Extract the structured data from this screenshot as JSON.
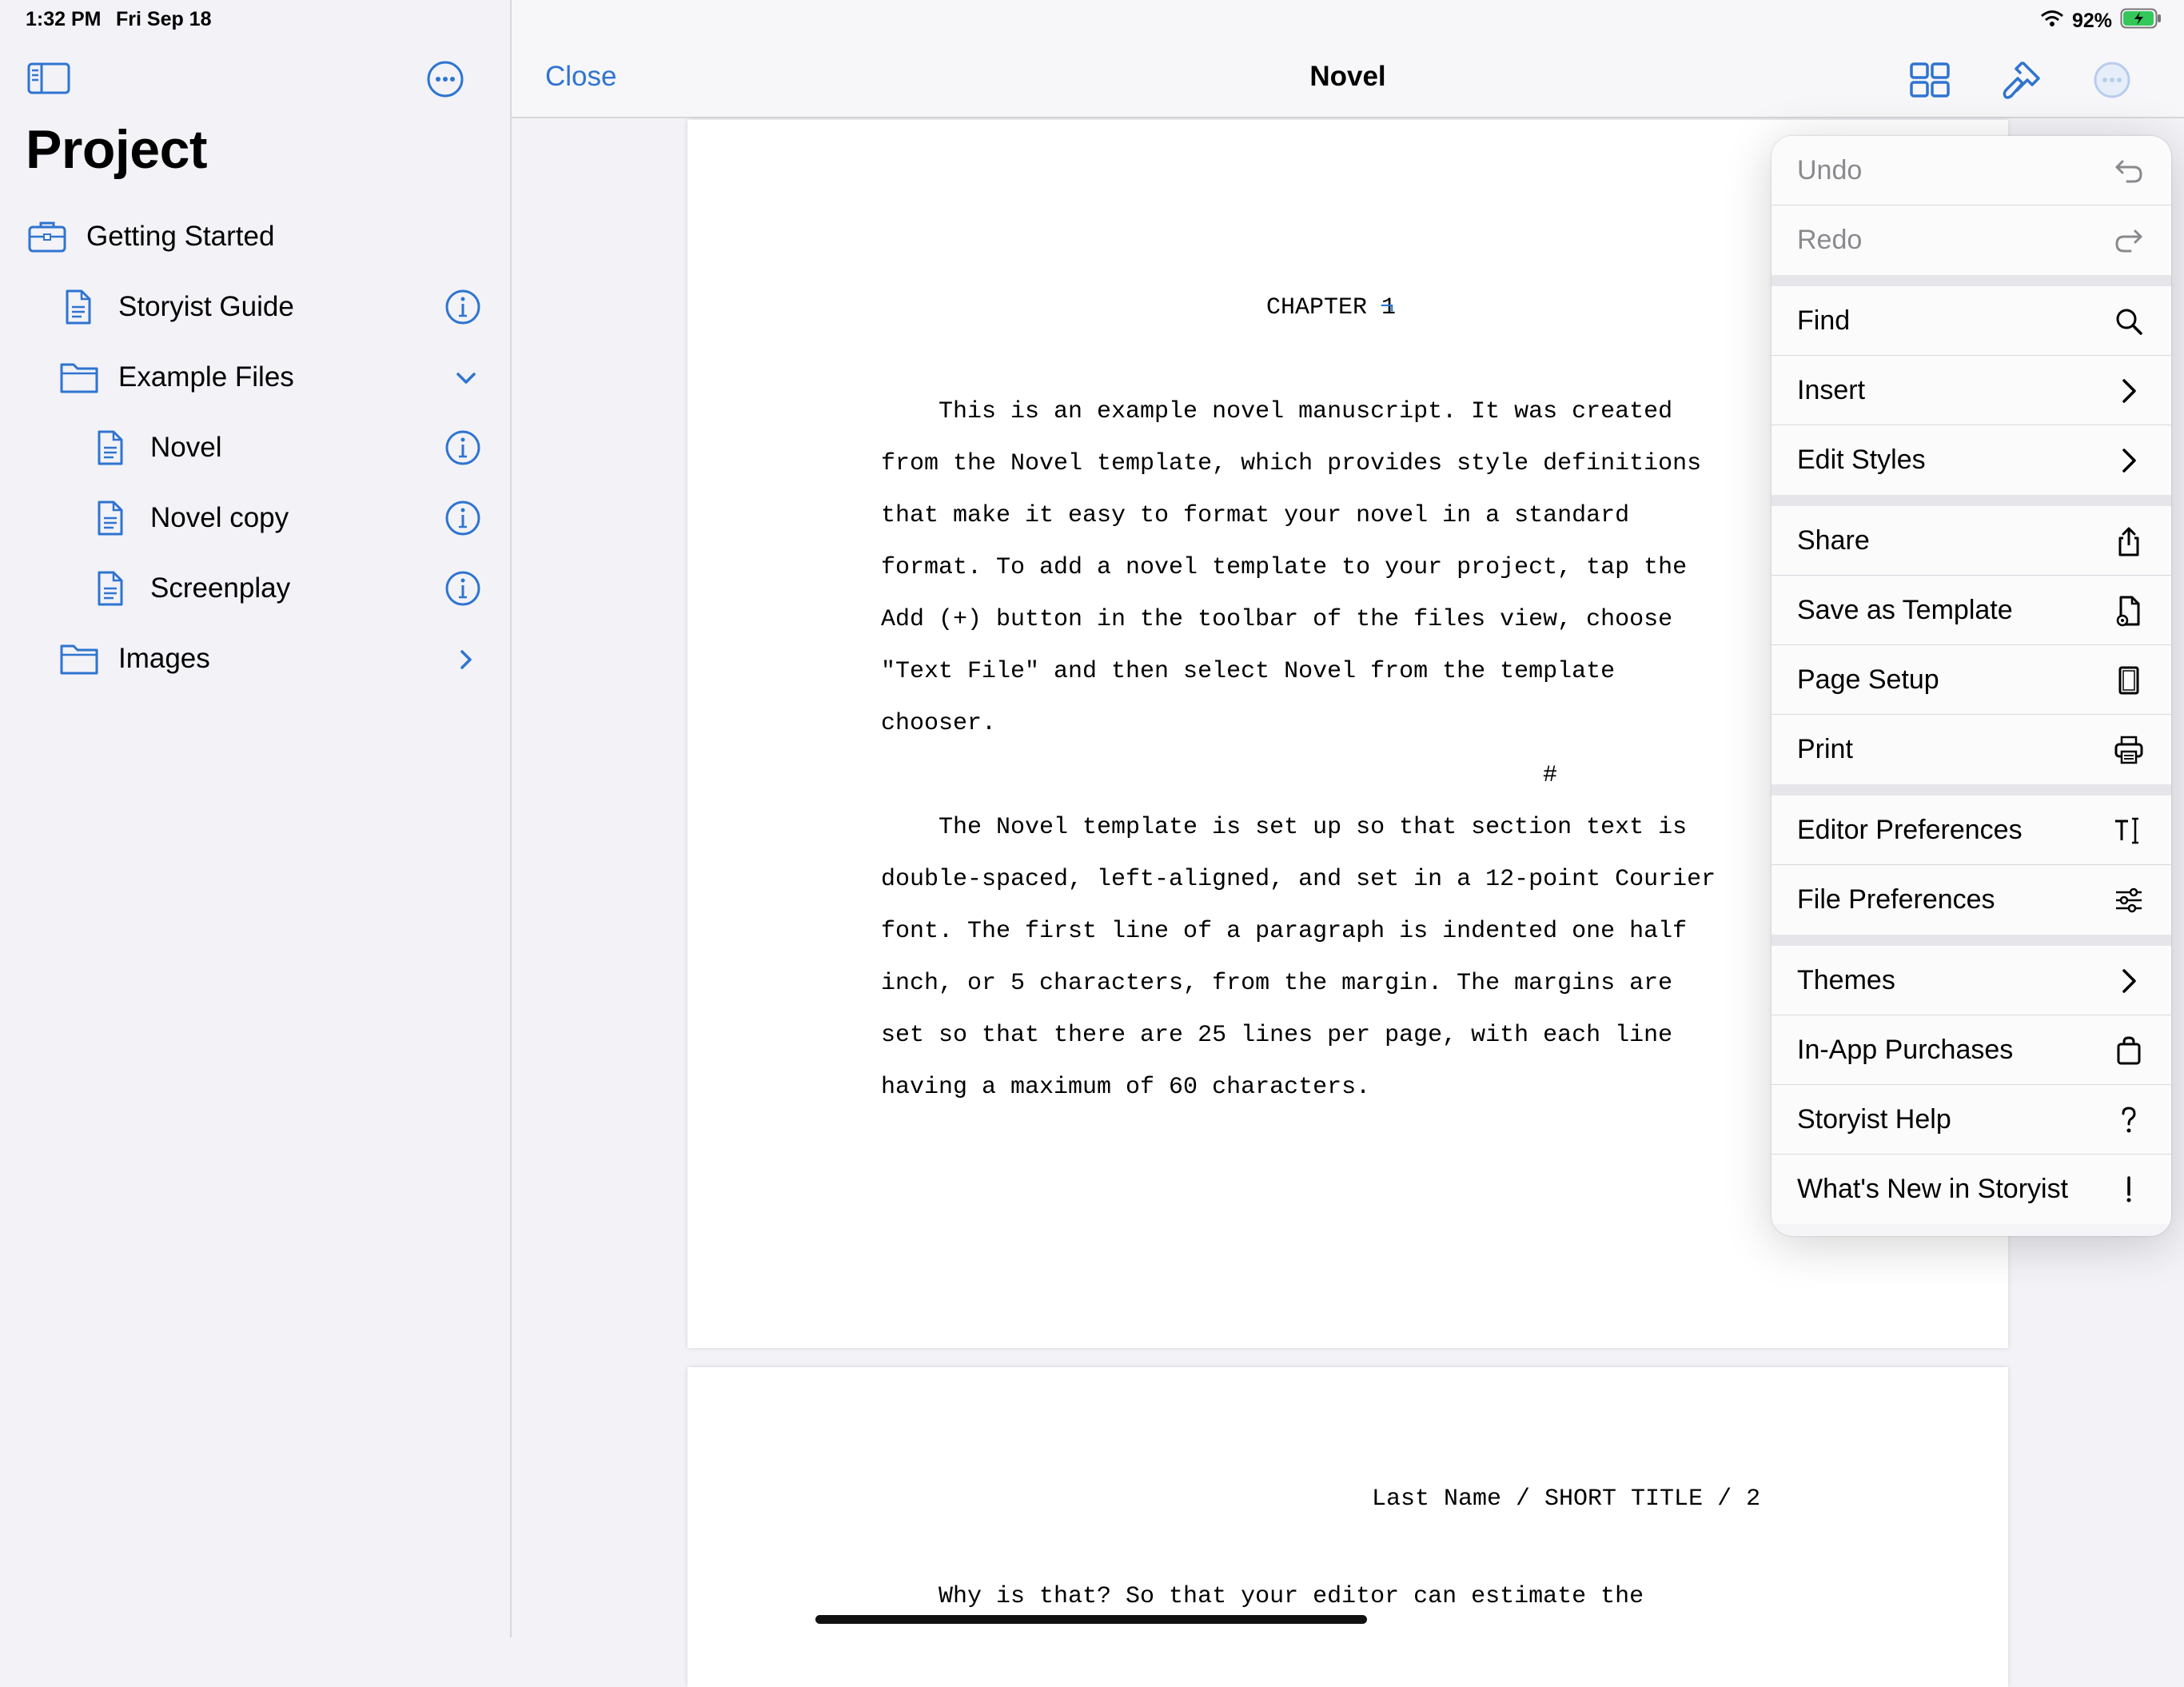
{
  "status_bar": {
    "time": "1:32 PM",
    "date": "Fri Sep 18",
    "battery": "92%"
  },
  "sidebar": {
    "title": "Project",
    "items": [
      {
        "label": "Getting Started",
        "icon": "briefcase-icon"
      },
      {
        "label": "Storyist Guide",
        "icon": "document-icon"
      },
      {
        "label": "Example Files",
        "icon": "folder-icon"
      },
      {
        "label": "Novel",
        "icon": "document-icon"
      },
      {
        "label": "Novel copy",
        "icon": "document-icon"
      },
      {
        "label": "Screenplay",
        "icon": "document-icon"
      },
      {
        "label": "Images",
        "icon": "folder-icon"
      }
    ]
  },
  "navbar": {
    "close_label": "Close",
    "title": "Novel"
  },
  "document": {
    "page1": {
      "heading": "CHAPTER 1",
      "lines": [
        "    This is an example novel manuscript. It was created",
        "from the Novel template, which provides style definitions",
        "that make it easy to format your novel in a standard",
        "format. To add a novel template to your project, tap the",
        "Add (+) button in the toolbar of the files view, choose",
        "\"Text File\" and then select Novel from the template",
        "chooser.",
        "#",
        "    The Novel template is set up so that section text is",
        "double-spaced, left-aligned, and set in a 12-point Courier",
        "font. The first line of a paragraph is indented one half",
        "inch, or 5 characters, from the margin. The margins are",
        "set so that there are 25 lines per page, with each line",
        "having a maximum of 60 characters."
      ]
    },
    "page2": {
      "header": "Last Name / SHORT TITLE / 2",
      "first_line": "    Why is that? So that your editor can estimate the"
    }
  },
  "menu": {
    "items": [
      {
        "label": "Undo",
        "icon": "undo-icon",
        "disabled": true
      },
      {
        "label": "Redo",
        "icon": "redo-icon",
        "disabled": true
      },
      {
        "label": "Find",
        "icon": "search-icon"
      },
      {
        "label": "Insert",
        "icon": "chevron-right-icon"
      },
      {
        "label": "Edit Styles",
        "icon": "chevron-right-icon"
      },
      {
        "label": "Share",
        "icon": "share-icon"
      },
      {
        "label": "Save as Template",
        "icon": "template-icon"
      },
      {
        "label": "Page Setup",
        "icon": "page-setup-icon"
      },
      {
        "label": "Print",
        "icon": "printer-icon"
      },
      {
        "label": "Editor Preferences",
        "icon": "text-cursor-icon"
      },
      {
        "label": "File Preferences",
        "icon": "sliders-icon"
      },
      {
        "label": "Themes",
        "icon": "chevron-right-icon"
      },
      {
        "label": "In-App Purchases",
        "icon": "shopping-bag-icon"
      },
      {
        "label": "Storyist Help",
        "icon": "question-icon"
      },
      {
        "label": "What's New in Storyist",
        "icon": "exclamation-icon"
      }
    ]
  },
  "colors": {
    "accent": "#2f74d0",
    "background": "#f2f2f7",
    "page": "#ffffff"
  }
}
